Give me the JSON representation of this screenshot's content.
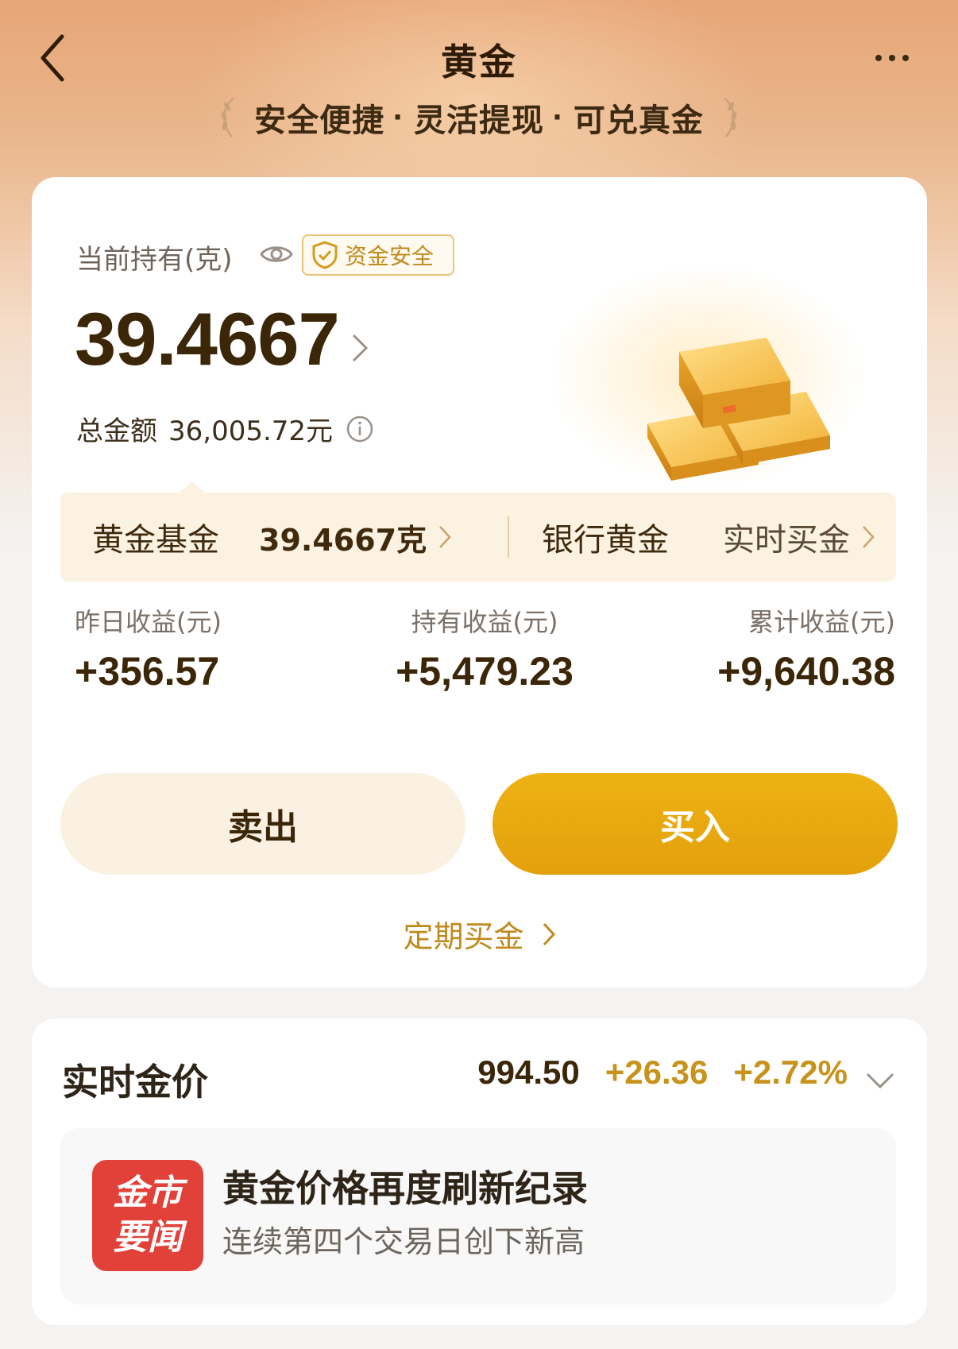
{
  "header": {
    "title": "黄金",
    "taglines": [
      "安全便捷",
      "灵活提现",
      "可兑真金"
    ],
    "tagline_sep": "·"
  },
  "holding": {
    "label": "当前持有(克)",
    "badge": "资金安全",
    "grams": "39.4667",
    "total_label": "总金额",
    "total_value": "36,005.72元"
  },
  "products": {
    "fund_name": "黄金基金",
    "fund_value": "39.4667克",
    "bank_name": "银行黄金",
    "bank_action": "实时买金"
  },
  "stats": [
    {
      "label": "昨日收益(元)",
      "value": "+356.57"
    },
    {
      "label": "持有收益(元)",
      "value": "+5,479.23"
    },
    {
      "label": "累计收益(元)",
      "value": "+9,640.38"
    }
  ],
  "actions": {
    "sell": "卖出",
    "buy": "买入",
    "regular": "定期买金"
  },
  "price": {
    "title": "实时金价",
    "now": "994.50",
    "change": "+26.36",
    "percent": "+2.72%"
  },
  "news": {
    "logo_line1": "金市",
    "logo_line2": "要闻",
    "title": "黄金价格再度刷新纪录",
    "subtitle": "连续第四个交易日创下新高"
  },
  "colors": {
    "accent_gold": "#e3a00c",
    "gain_gold": "#c8931d",
    "news_red": "#e2413a"
  }
}
